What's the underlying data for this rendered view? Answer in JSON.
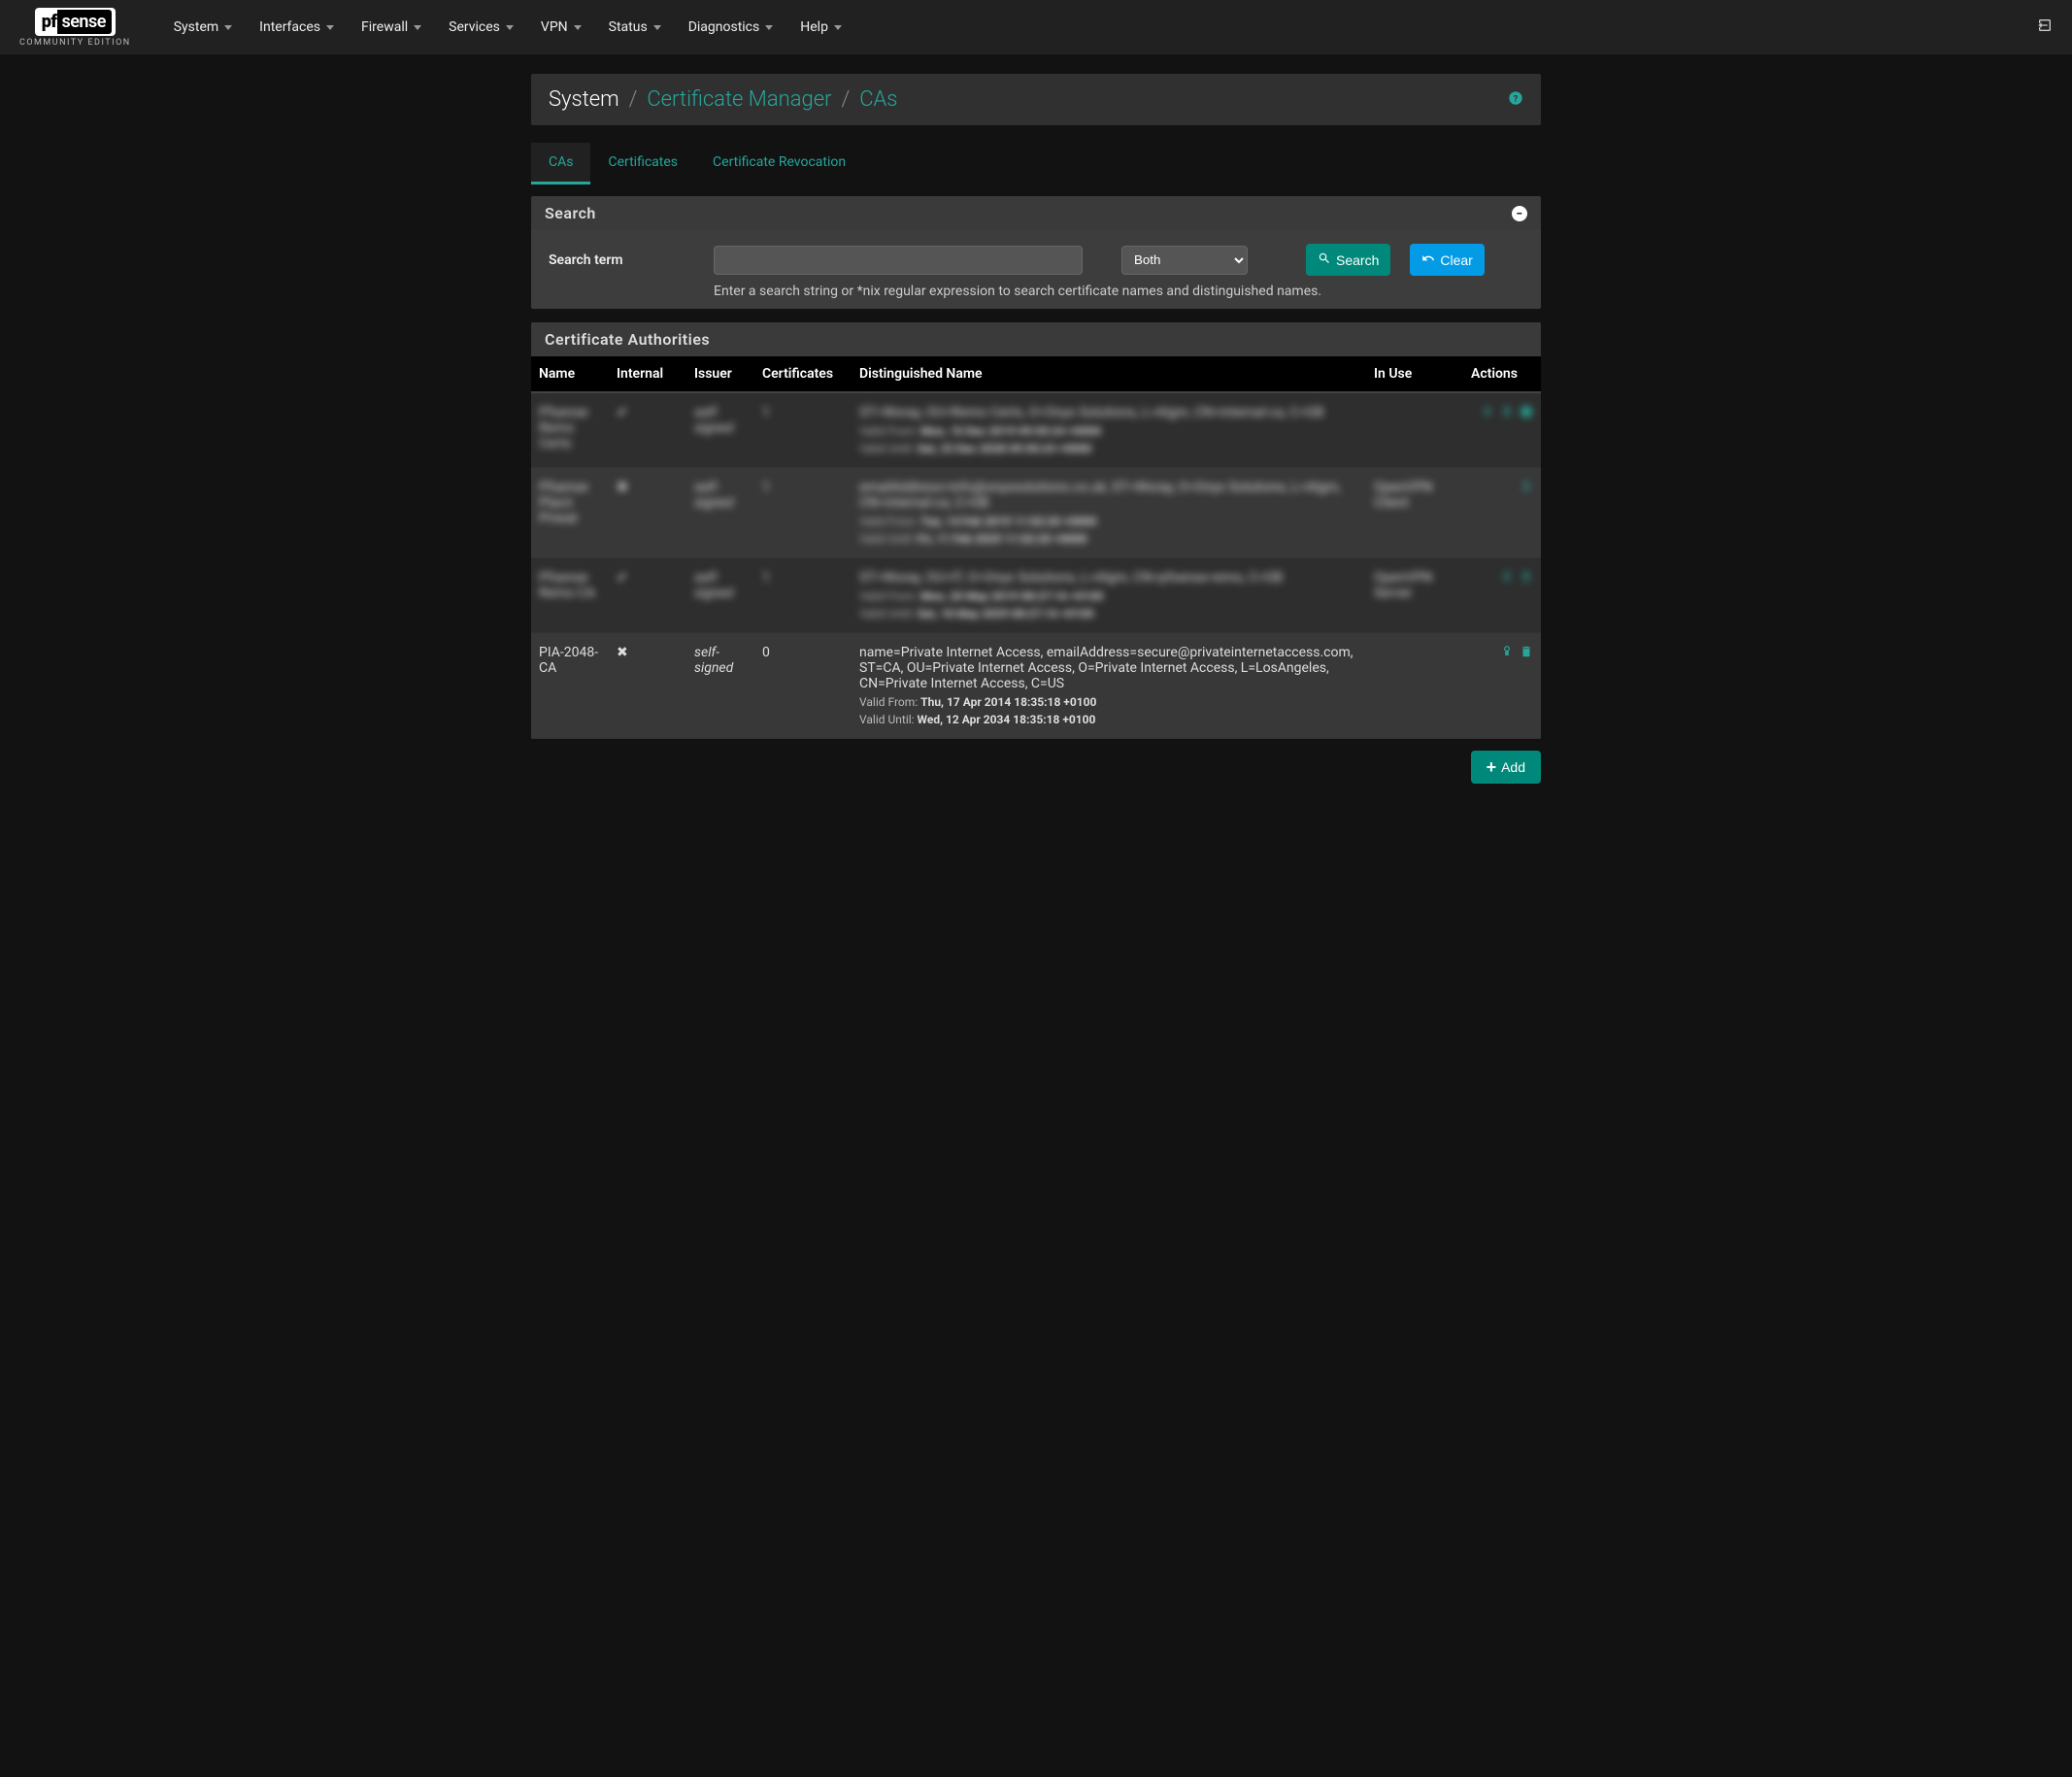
{
  "logo": {
    "pf": "pf",
    "sense": "sense",
    "subtitle": "COMMUNITY EDITION"
  },
  "nav": {
    "items": [
      "System",
      "Interfaces",
      "Firewall",
      "Services",
      "VPN",
      "Status",
      "Diagnostics",
      "Help"
    ]
  },
  "breadcrumb": {
    "root": "System",
    "mid": "Certificate Manager",
    "leaf": "CAs"
  },
  "tabs": {
    "items": [
      "CAs",
      "Certificates",
      "Certificate Revocation"
    ],
    "active": 0
  },
  "search": {
    "panel_title": "Search",
    "label": "Search term",
    "value": "",
    "placeholder": "",
    "scope_selected": "Both",
    "search_btn": "Search",
    "clear_btn": "Clear",
    "hint": "Enter a search string or *nix regular expression to search certificate names and distinguished names."
  },
  "ca_table": {
    "panel_title": "Certificate Authorities",
    "columns": [
      "Name",
      "Internal",
      "Issuer",
      "Certificates",
      "Distinguished Name",
      "In Use",
      "Actions"
    ],
    "rows": [
      {
        "blurred": true,
        "name": "Pfsense Remo Certs",
        "internal": "check",
        "issuer": "self-signed",
        "certs": "1",
        "dn": "ST=Woray, OU=Remo Certs, O=Onyx Solutions, L=Algm, CN=internal-ca, C=GB",
        "valid_from": "Mon, 10 Dec 2019 09:50:24 +0000",
        "valid_until": "Sat, 23 Dec 2028 09:50:24 +0000",
        "in_use": "",
        "actions": [
          "edit",
          "cert",
          "export",
          "info"
        ]
      },
      {
        "blurred": true,
        "name": "Pfsense Placn Priwat",
        "internal": "x",
        "issuer": "self-signed",
        "certs": "1",
        "dn": "emailAddress=info@onyxsolutions.co.uk, ST=Woray, O=Onyx Solutions, L=Algm, CN=internal-ca, C=GB",
        "valid_from": "Tue, 14 Feb 2019 11:02:20 +0000",
        "valid_until": "Fri, 11 Feb 2029 11:02:20 +0000",
        "in_use": "OpenVPN Client",
        "actions": [
          "edit",
          "cert"
        ]
      },
      {
        "blurred": true,
        "name": "Pfsense Remo CA",
        "internal": "check",
        "issuer": "self-signed",
        "certs": "1",
        "dn": "ST=Woray, OU=IT, O=Onyx Solutions, L=Algm, CN=pfsense-remo, C=GB",
        "valid_from": "Mon, 20 May 2019 08:27:16 +0100",
        "valid_until": "Sat, 18 May 2029 08:27:16 +0100",
        "in_use": "OpenVPN Server",
        "actions": [
          "edit",
          "cert",
          "export"
        ]
      },
      {
        "blurred": false,
        "name": "PIA-2048-CA",
        "internal": "x",
        "issuer": "self-signed",
        "certs": "0",
        "dn": "name=Private Internet Access, emailAddress=secure@privateinternetaccess.com, ST=CA, OU=Private Internet Access, O=Private Internet Access, L=LosAngeles, CN=Private Internet Access, C=US",
        "valid_from": "Thu, 17 Apr 2014 18:35:18 +0100",
        "valid_until": "Wed, 12 Apr 2034 18:35:18 +0100",
        "in_use": "",
        "actions": [
          "edit",
          "cert",
          "trash"
        ]
      }
    ]
  },
  "labels": {
    "valid_from": "Valid From: ",
    "valid_until": "Valid Until: ",
    "add_btn": "Add"
  }
}
